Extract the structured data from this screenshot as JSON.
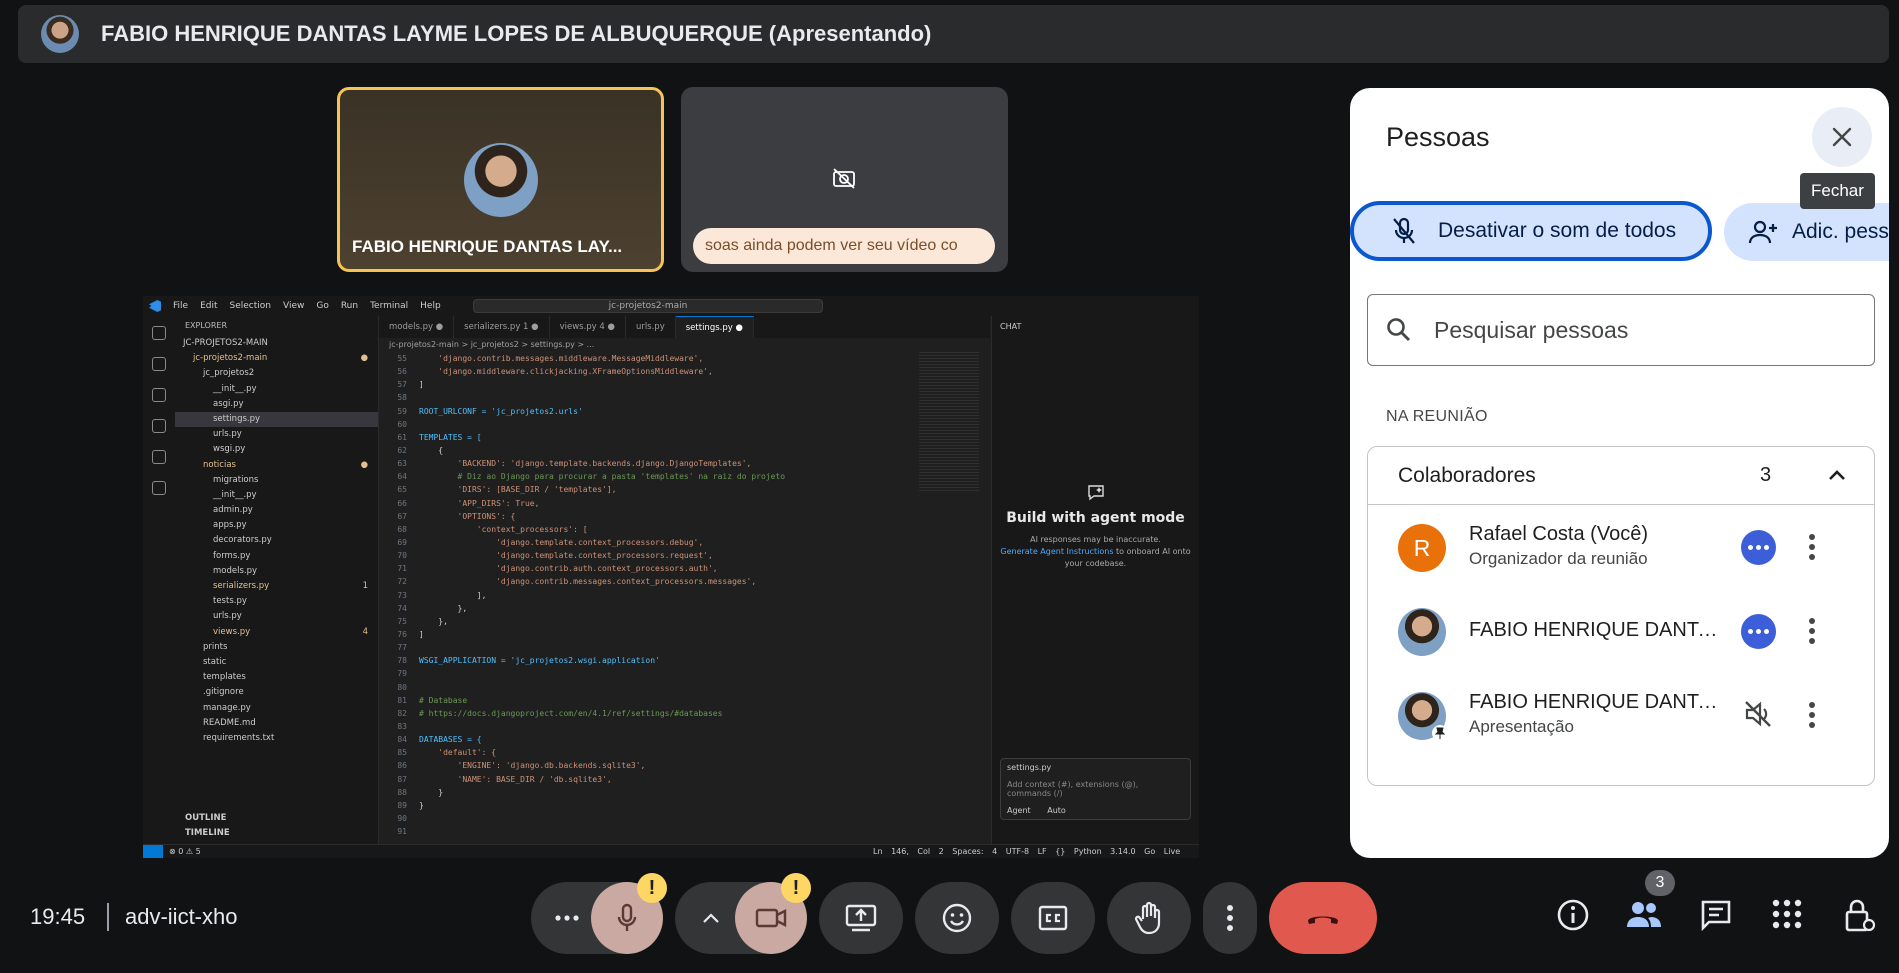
{
  "presenter_bar": {
    "title": "FABIO HENRIQUE DANTAS LAYME LOPES DE ALBUQUERQUE (Apresentando)"
  },
  "tiles": [
    {
      "name": "FABIO HENRIQUE DANTAS LAY..."
    },
    {
      "notice": "soas ainda podem ver seu vídeo co"
    }
  ],
  "vscode": {
    "menu": [
      "File",
      "Edit",
      "Selection",
      "View",
      "Go",
      "Run",
      "Terminal",
      "Help"
    ],
    "search": "jc-projetos2-main",
    "explorer_title": "EXPLORER",
    "tree": [
      {
        "label": "JC-PROJETOS2-MAIN",
        "indent": 0,
        "color": "#cccccc"
      },
      {
        "label": "jc-projetos2-main",
        "indent": 1,
        "color": "#e2c08d",
        "mark": "●"
      },
      {
        "label": "jc_projetos2",
        "indent": 2,
        "color": "#cccccc"
      },
      {
        "label": "__init__.py",
        "indent": 3,
        "color": "#cccccc"
      },
      {
        "label": "asgi.py",
        "indent": 3,
        "color": "#cccccc"
      },
      {
        "label": "settings.py",
        "indent": 3,
        "color": "#cccccc",
        "selected": true
      },
      {
        "label": "urls.py",
        "indent": 3,
        "color": "#cccccc"
      },
      {
        "label": "wsgi.py",
        "indent": 3,
        "color": "#cccccc"
      },
      {
        "label": "noticias",
        "indent": 2,
        "color": "#e2c08d",
        "mark": "●"
      },
      {
        "label": "migrations",
        "indent": 3,
        "color": "#cccccc"
      },
      {
        "label": "__init__.py",
        "indent": 3,
        "color": "#cccccc"
      },
      {
        "label": "admin.py",
        "indent": 3,
        "color": "#cccccc"
      },
      {
        "label": "apps.py",
        "indent": 3,
        "color": "#cccccc"
      },
      {
        "label": "decorators.py",
        "indent": 3,
        "color": "#cccccc"
      },
      {
        "label": "forms.py",
        "indent": 3,
        "color": "#cccccc"
      },
      {
        "label": "models.py",
        "indent": 3,
        "color": "#cccccc"
      },
      {
        "label": "serializers.py",
        "indent": 3,
        "color": "#e2c08d",
        "mark": "1"
      },
      {
        "label": "tests.py",
        "indent": 3,
        "color": "#cccccc"
      },
      {
        "label": "urls.py",
        "indent": 3,
        "color": "#cccccc"
      },
      {
        "label": "views.py",
        "indent": 3,
        "color": "#e2c08d",
        "mark": "4"
      },
      {
        "label": "prints",
        "indent": 2,
        "color": "#cccccc"
      },
      {
        "label": "static",
        "indent": 2,
        "color": "#cccccc"
      },
      {
        "label": "templates",
        "indent": 2,
        "color": "#cccccc"
      },
      {
        "label": ".gitignore",
        "indent": 2,
        "color": "#cccccc"
      },
      {
        "label": "manage.py",
        "indent": 2,
        "color": "#cccccc"
      },
      {
        "label": "README.md",
        "indent": 2,
        "color": "#cccccc"
      },
      {
        "label": "requirements.txt",
        "indent": 2,
        "color": "#cccccc"
      }
    ],
    "outline": "OUTLINE",
    "timeline": "TIMELINE",
    "tabs": [
      {
        "label": "models.py ●",
        "active": false
      },
      {
        "label": "serializers.py 1 ●",
        "active": false
      },
      {
        "label": "views.py 4 ●",
        "active": false
      },
      {
        "label": "urls.py",
        "active": false
      },
      {
        "label": "settings.py ●",
        "active": true
      }
    ],
    "breadcrumb": "jc-projetos2-main > jc_projetos2 > settings.py > ...",
    "code": [
      {
        "n": "55",
        "t": "    'django.contrib.messages.middleware.MessageMiddleware',",
        "c": ""
      },
      {
        "n": "56",
        "t": "    'django.middleware.clickjacking.XFrameOptionsMiddleware',",
        "c": ""
      },
      {
        "n": "57",
        "t": "]",
        "c": "p"
      },
      {
        "n": "58",
        "t": "",
        "c": "p"
      },
      {
        "n": "59",
        "t": "ROOT_URLCONF = 'jc_projetos2.urls'",
        "c": "k"
      },
      {
        "n": "60",
        "t": "",
        "c": "p"
      },
      {
        "n": "61",
        "t": "TEMPLATES = [",
        "c": "k"
      },
      {
        "n": "62",
        "t": "    {",
        "c": "p"
      },
      {
        "n": "63",
        "t": "        'BACKEND': 'django.template.backends.django.DjangoTemplates',",
        "c": ""
      },
      {
        "n": "64",
        "t": "        # Diz ao Django para procurar a pasta 'templates' na raiz do projeto",
        "c": "c"
      },
      {
        "n": "65",
        "t": "        'DIRS': [BASE_DIR / 'templates'],",
        "c": ""
      },
      {
        "n": "66",
        "t": "        'APP_DIRS': True,",
        "c": ""
      },
      {
        "n": "67",
        "t": "        'OPTIONS': {",
        "c": ""
      },
      {
        "n": "68",
        "t": "            'context_processors': [",
        "c": ""
      },
      {
        "n": "69",
        "t": "                'django.template.context_processors.debug',",
        "c": ""
      },
      {
        "n": "70",
        "t": "                'django.template.context_processors.request',",
        "c": ""
      },
      {
        "n": "71",
        "t": "                'django.contrib.auth.context_processors.auth',",
        "c": ""
      },
      {
        "n": "72",
        "t": "                'django.contrib.messages.context_processors.messages',",
        "c": ""
      },
      {
        "n": "73",
        "t": "            ],",
        "c": "p"
      },
      {
        "n": "74",
        "t": "        },",
        "c": "p"
      },
      {
        "n": "75",
        "t": "    },",
        "c": "p"
      },
      {
        "n": "76",
        "t": "]",
        "c": "p"
      },
      {
        "n": "77",
        "t": "",
        "c": "p"
      },
      {
        "n": "78",
        "t": "WSGI_APPLICATION = 'jc_projetos2.wsgi.application'",
        "c": "k"
      },
      {
        "n": "79",
        "t": "",
        "c": "p"
      },
      {
        "n": "80",
        "t": "",
        "c": "p"
      },
      {
        "n": "81",
        "t": "# Database",
        "c": "c"
      },
      {
        "n": "82",
        "t": "# https://docs.djangoproject.com/en/4.1/ref/settings/#databases",
        "c": "c"
      },
      {
        "n": "83",
        "t": "",
        "c": "p"
      },
      {
        "n": "84",
        "t": "DATABASES = {",
        "c": "k"
      },
      {
        "n": "85",
        "t": "    'default': {",
        "c": ""
      },
      {
        "n": "86",
        "t": "        'ENGINE': 'django.db.backends.sqlite3',",
        "c": ""
      },
      {
        "n": "87",
        "t": "        'NAME': BASE_DIR / 'db.sqlite3',",
        "c": ""
      },
      {
        "n": "88",
        "t": "    }",
        "c": "p"
      },
      {
        "n": "89",
        "t": "}",
        "c": "p"
      },
      {
        "n": "90",
        "t": "",
        "c": "p"
      },
      {
        "n": "91",
        "t": "",
        "c": "p"
      }
    ],
    "chat_tab": "CHAT",
    "chat_title": "Build with agent mode",
    "chat_note": "AI responses may be inaccurate.",
    "chat_link": "Generate Agent Instructions",
    "chat_link_suffix": "to onboard AI onto your codebase.",
    "chat_context_file": "settings.py",
    "chat_placeholder": "Add context (#), extensions (@), commands (/)",
    "chat_mode": "Agent",
    "chat_model": "Auto",
    "status_problems": "⊗ 0 ⚠ 5",
    "status_right": "Ln 146, Col 2   Spaces: 4   UTF-8   LF   {} Python   3.14.0   Go Live"
  },
  "people_panel": {
    "title": "Pessoas",
    "close_tooltip": "Fechar",
    "mute_all": "Desativar o som de todos",
    "add_people": "Adic. pessoas",
    "search_placeholder": "Pesquisar pessoas",
    "section": "NA REUNIÃO",
    "group_title": "Colaboradores",
    "group_count": "3",
    "people": [
      {
        "name": "Rafael Costa (Você)",
        "sub": "Organizador da reunião",
        "initial": "R"
      },
      {
        "name": "FABIO HENRIQUE DANTA...",
        "sub": ""
      },
      {
        "name": "FABIO HENRIQUE DANTA...",
        "sub": "Apresentação"
      }
    ]
  },
  "bottom_bar": {
    "time": "19:45",
    "meeting_code": "adv-iict-xho",
    "warning_badge": "!",
    "participants_count": "3"
  }
}
